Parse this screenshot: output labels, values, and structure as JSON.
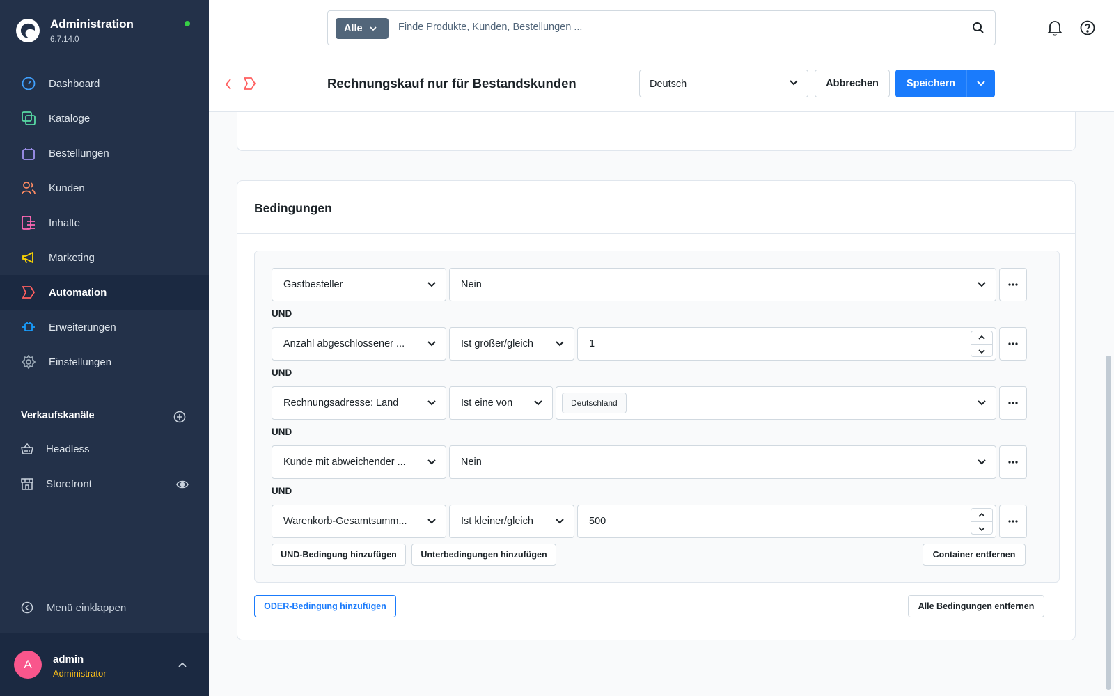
{
  "app": {
    "title": "Administration",
    "version": "6.7.14.0"
  },
  "nav": {
    "items": [
      {
        "label": "Dashboard",
        "icon": "dashboard-icon",
        "color": "#40a1ff"
      },
      {
        "label": "Kataloge",
        "icon": "catalog-icon",
        "color": "#57d9a3"
      },
      {
        "label": "Bestellungen",
        "icon": "orders-icon",
        "color": "#a092f0"
      },
      {
        "label": "Kunden",
        "icon": "customers-icon",
        "color": "#f88962"
      },
      {
        "label": "Inhalte",
        "icon": "content-icon",
        "color": "#ff68b4"
      },
      {
        "label": "Marketing",
        "icon": "marketing-icon",
        "color": "#ffd700"
      },
      {
        "label": "Automation",
        "icon": "automation-icon",
        "color": "#ff5f5f"
      },
      {
        "label": "Erweiterungen",
        "icon": "extensions-icon",
        "color": "#189eff"
      },
      {
        "label": "Einstellungen",
        "icon": "settings-icon",
        "color": "#9aa8b5"
      }
    ]
  },
  "sales_channels": {
    "title": "Verkaufskanäle",
    "items": [
      {
        "label": "Headless",
        "icon": "basket-icon"
      },
      {
        "label": "Storefront",
        "icon": "storefront-icon"
      }
    ]
  },
  "collapse_label": "Menü einklappen",
  "user": {
    "initial": "A",
    "name": "admin",
    "role": "Administrator"
  },
  "search": {
    "type": "Alle",
    "placeholder": "Finde Produkte, Kunden, Bestellungen ..."
  },
  "smartbar": {
    "title": "Rechnungskauf nur für Bestandskunden",
    "language": "Deutsch",
    "cancel": "Abbrechen",
    "save": "Speichern"
  },
  "conditions": {
    "title": "Bedingungen",
    "and_label": "UND",
    "rows": [
      {
        "type": "Gastbesteller",
        "operator": "",
        "value": "Nein"
      },
      {
        "type": "Anzahl abgeschlossener ...",
        "operator": "Ist größer/gleich",
        "value": "1"
      },
      {
        "type": "Rechnungsadresse: Land",
        "operator": "Ist eine von",
        "value": "Deutschland"
      },
      {
        "type": "Kunde mit abweichender ...",
        "operator": "",
        "value": "Nein"
      },
      {
        "type": "Warenkorb-Gesamtsumm...",
        "operator": "Ist kleiner/gleich",
        "value": "500"
      }
    ],
    "add_and": "UND-Bedingung hinzufügen",
    "add_sub": "Unterbedingungen hinzufügen",
    "remove_container": "Container entfernen",
    "add_or": "ODER-Bedingung hinzufügen",
    "remove_all": "Alle Bedingungen entfernen"
  },
  "colors": {
    "sidebar": "#233149",
    "primary": "#1a7bfc",
    "avatar": "#f9568c",
    "role": "#ffc21a",
    "online": "#37d046"
  }
}
